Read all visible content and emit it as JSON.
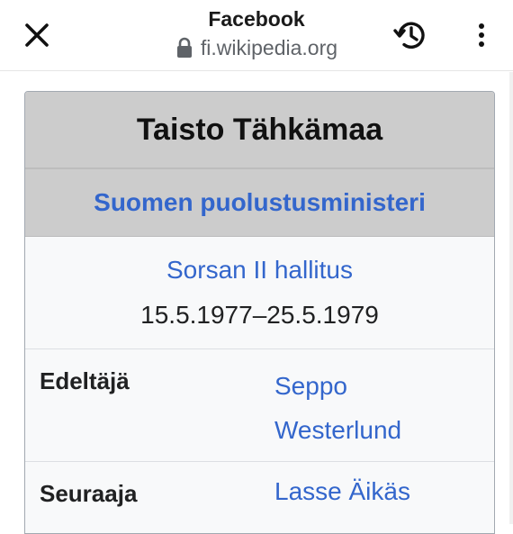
{
  "browser": {
    "page_title": "Facebook",
    "url": "fi.wikipedia.org",
    "icons": {
      "close": "close-icon",
      "lock": "lock-icon",
      "history": "history-icon",
      "menu": "more-vert-icon"
    }
  },
  "infobox": {
    "title": "Taisto Tähkämaa",
    "office": "Suomen puolustusministeri",
    "cabinet": "Sorsan II hallitus",
    "term": "15.5.1977–25.5.1979",
    "rows": [
      {
        "label": "Edeltäjä",
        "value": "Seppo Westerlund"
      },
      {
        "label": "Seuraaja",
        "value": "Lasse Äikäs"
      }
    ]
  },
  "colors": {
    "link": "#3366cc",
    "header_bg": "#cccccc",
    "box_bg": "#f8f9fa"
  }
}
